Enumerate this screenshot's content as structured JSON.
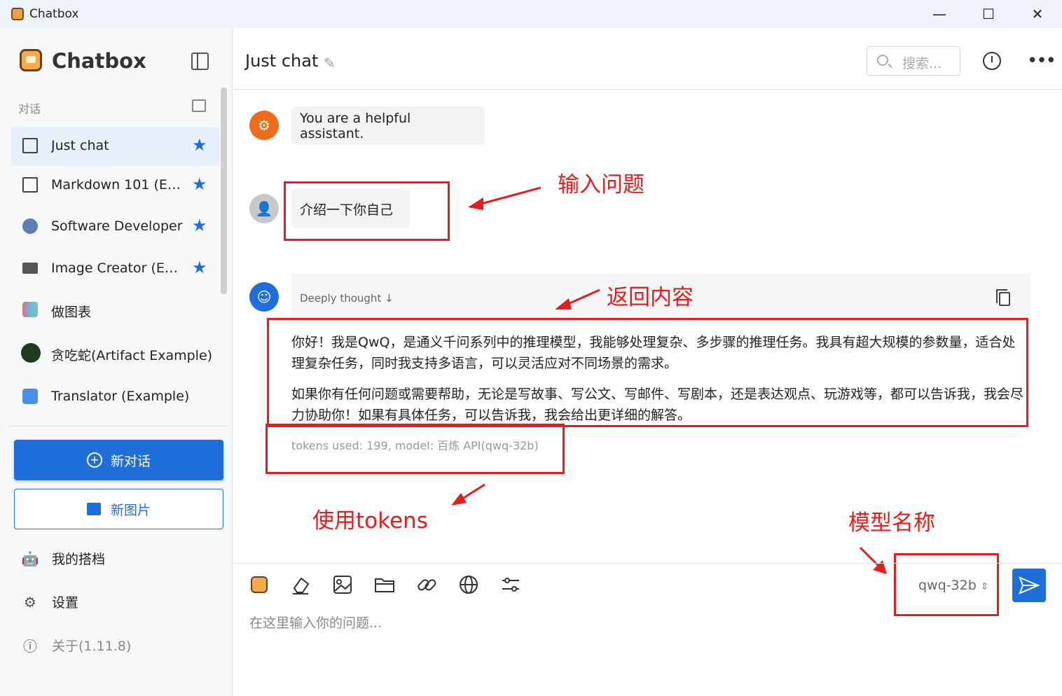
{
  "window": {
    "title": "Chatbox",
    "minimize_label": "—",
    "maximize_label": "☐",
    "close_label": "✕"
  },
  "sidebar": {
    "brand": "Chatbox",
    "section_label": "对话",
    "conversations": [
      {
        "label": "Just chat",
        "icon": "chat-bubble-icon",
        "starred": true,
        "active": true
      },
      {
        "label": "Markdown 101 (Example)",
        "icon": "chat-bubble-icon",
        "starred": true
      },
      {
        "label": "Software Developer",
        "icon": "developer-avatar-icon",
        "starred": true
      },
      {
        "label": "Image Creator (Example)",
        "icon": "image-icon",
        "starred": true
      },
      {
        "label": "做图表",
        "icon": "chart-avatar-icon",
        "starred": false
      },
      {
        "label": "贪吃蛇(Artifact Example)",
        "icon": "snake-avatar-icon",
        "starred": false
      },
      {
        "label": "Translator (Example)",
        "icon": "translate-avatar-icon",
        "starred": false
      }
    ],
    "new_chat_label": "新对话",
    "new_image_label": "新图片",
    "menu": [
      {
        "label": "我的搭档",
        "icon": "robot-icon"
      },
      {
        "label": "设置",
        "icon": "gear-icon"
      },
      {
        "label": "关于(1.11.8)",
        "icon": "info-icon"
      }
    ],
    "colors": {
      "accent": "#1e6fd9"
    }
  },
  "header": {
    "chat_title": "Just chat",
    "search_placeholder": "搜索..."
  },
  "messages": {
    "system": "You are a helpful assistant.",
    "user": "介绍一下你自己",
    "thought_label": "Deeply thought",
    "assistant_paragraphs": [
      "你好！我是QwQ，是通义千问系列中的推理模型，我能够处理复杂、多步骤的推理任务。我具有超大规模的参数量，适合处理复杂任务，同时我支持多语言，可以灵活应对不同场景的需求。",
      "如果你有任何问题或需要帮助，无论是写故事、写公文、写邮件、写剧本，还是表达观点、玩游戏等，都可以告诉我，我会尽力协助你！如果有具体任务，可以告诉我，我会给出更详细的解答。"
    ],
    "meta": "tokens used: 199, model: 百炼 API(qwq-32b)"
  },
  "annotations": {
    "input_question": "输入问题",
    "return_content": "返回内容",
    "use_tokens": "使用tokens",
    "model_name": "模型名称",
    "color": "#e51d1d"
  },
  "composer": {
    "model": "qwq-32b",
    "placeholder": "在这里输入你的问题..."
  }
}
